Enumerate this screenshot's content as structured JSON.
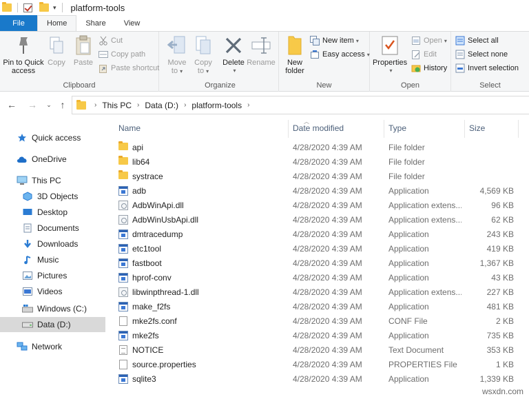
{
  "window": {
    "title": "platform-tools"
  },
  "ribbon_tabs": [
    {
      "label": "File"
    },
    {
      "label": "Home"
    },
    {
      "label": "Share"
    },
    {
      "label": "View"
    }
  ],
  "ribbon": {
    "clipboard": {
      "label": "Clipboard",
      "pin": "Pin to Quick access",
      "pin_line1": "Pin to Quick",
      "pin_line2": "access",
      "copy": "Copy",
      "paste": "Paste",
      "cut": "Cut",
      "copy_path": "Copy path",
      "paste_shortcut": "Paste shortcut"
    },
    "organize": {
      "label": "Organize",
      "move_to_1": "Move",
      "move_to_2": "to",
      "copy_to_1": "Copy",
      "copy_to_2": "to",
      "delete": "Delete",
      "rename": "Rename"
    },
    "new": {
      "label": "New",
      "new_folder_1": "New",
      "new_folder_2": "folder",
      "new_item": "New item",
      "easy_access": "Easy access"
    },
    "open": {
      "label": "Open",
      "properties": "Properties",
      "open": "Open",
      "edit": "Edit",
      "history": "History"
    },
    "select": {
      "label": "Select",
      "select_all": "Select all",
      "select_none": "Select none",
      "invert_selection": "Invert selection"
    }
  },
  "breadcrumb": [
    "This PC",
    "Data (D:)",
    "platform-tools"
  ],
  "nav_pane": {
    "quick_access": "Quick access",
    "onedrive": "OneDrive",
    "this_pc": "This PC",
    "objects3d": "3D Objects",
    "desktop": "Desktop",
    "documents": "Documents",
    "downloads": "Downloads",
    "music": "Music",
    "pictures": "Pictures",
    "videos": "Videos",
    "windows_c": "Windows (C:)",
    "data_d": "Data (D:)",
    "network": "Network"
  },
  "columns": {
    "name": "Name",
    "date": "Date modified",
    "type": "Type",
    "size": "Size"
  },
  "files": [
    {
      "name": "api",
      "date": "4/28/2020 4:39 AM",
      "type": "File folder",
      "size": "",
      "icon": "folder-icon"
    },
    {
      "name": "lib64",
      "date": "4/28/2020 4:39 AM",
      "type": "File folder",
      "size": "",
      "icon": "folder-icon"
    },
    {
      "name": "systrace",
      "date": "4/28/2020 4:39 AM",
      "type": "File folder",
      "size": "",
      "icon": "folder-icon"
    },
    {
      "name": "adb",
      "date": "4/28/2020 4:39 AM",
      "type": "Application",
      "size": "4,569 KB",
      "icon": "application-icon"
    },
    {
      "name": "AdbWinApi.dll",
      "date": "4/28/2020 4:39 AM",
      "type": "Application extens...",
      "size": "96 KB",
      "icon": "dll-icon"
    },
    {
      "name": "AdbWinUsbApi.dll",
      "date": "4/28/2020 4:39 AM",
      "type": "Application extens...",
      "size": "62 KB",
      "icon": "dll-icon"
    },
    {
      "name": "dmtracedump",
      "date": "4/28/2020 4:39 AM",
      "type": "Application",
      "size": "243 KB",
      "icon": "application-icon"
    },
    {
      "name": "etc1tool",
      "date": "4/28/2020 4:39 AM",
      "type": "Application",
      "size": "419 KB",
      "icon": "application-icon"
    },
    {
      "name": "fastboot",
      "date": "4/28/2020 4:39 AM",
      "type": "Application",
      "size": "1,367 KB",
      "icon": "application-icon"
    },
    {
      "name": "hprof-conv",
      "date": "4/28/2020 4:39 AM",
      "type": "Application",
      "size": "43 KB",
      "icon": "application-icon"
    },
    {
      "name": "libwinpthread-1.dll",
      "date": "4/28/2020 4:39 AM",
      "type": "Application extens...",
      "size": "227 KB",
      "icon": "dll-icon"
    },
    {
      "name": "make_f2fs",
      "date": "4/28/2020 4:39 AM",
      "type": "Application",
      "size": "481 KB",
      "icon": "application-icon"
    },
    {
      "name": "mke2fs.conf",
      "date": "4/28/2020 4:39 AM",
      "type": "CONF File",
      "size": "2 KB",
      "icon": "document-icon"
    },
    {
      "name": "mke2fs",
      "date": "4/28/2020 4:39 AM",
      "type": "Application",
      "size": "735 KB",
      "icon": "application-icon"
    },
    {
      "name": "NOTICE",
      "date": "4/28/2020 4:39 AM",
      "type": "Text Document",
      "size": "353 KB",
      "icon": "text-document-icon"
    },
    {
      "name": "source.properties",
      "date": "4/28/2020 4:39 AM",
      "type": "PROPERTIES File",
      "size": "1 KB",
      "icon": "document-icon"
    },
    {
      "name": "sqlite3",
      "date": "4/28/2020 4:39 AM",
      "type": "Application",
      "size": "1,339 KB",
      "icon": "application-icon"
    }
  ],
  "watermark": "wsxdn.com",
  "colors": {
    "accent": "#1979ca",
    "selected_nav": "#cce8ff",
    "folder": "#f7c948"
  }
}
